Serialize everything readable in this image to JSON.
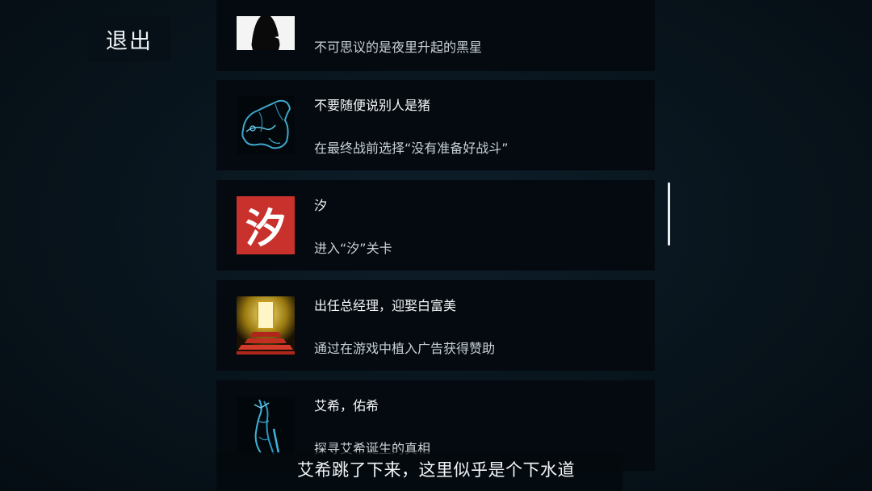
{
  "exit_label": "退出",
  "achievements": [
    {
      "title": "",
      "desc": "不可思议的是夜里升起的黑星",
      "icon": "black-star-icon"
    },
    {
      "title": "不要随便说别人是猪",
      "desc": "在最终战前选择“没有准备好战斗”",
      "icon": "pig-icon"
    },
    {
      "title": "汐",
      "desc": "进入“汐”关卡",
      "icon": "xi-character-icon",
      "icon_text": "汐"
    },
    {
      "title": "出任总经理，迎娶白富美",
      "desc": "通过在游戏中植入广告获得赞助",
      "icon": "golden-door-stairs-icon"
    },
    {
      "title": "艾希，佑希",
      "desc": "探寻艾希诞生的真相",
      "icon": "blue-figure-icon"
    }
  ],
  "subtitle": "艾希跳了下来，这里似乎是个下水道",
  "colors": {
    "background": "#08141c",
    "card": "#040a0f",
    "xi_red": "#c8312c",
    "gold": "#d9b52a",
    "cyan": "#3fb4d8"
  }
}
